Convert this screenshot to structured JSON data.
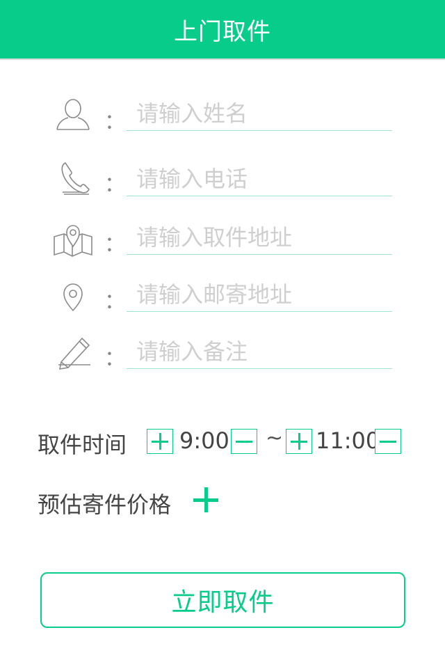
{
  "header": {
    "title": "上门取件"
  },
  "form": {
    "colon": "：",
    "fields": [
      {
        "icon": "person-icon",
        "placeholder": "请输入姓名",
        "value": ""
      },
      {
        "icon": "phone-icon",
        "placeholder": "请输入电话",
        "value": ""
      },
      {
        "icon": "map-pin-icon",
        "placeholder": "请输入取件地址",
        "value": ""
      },
      {
        "icon": "location-pin-icon",
        "placeholder": "请输入邮寄地址",
        "value": ""
      },
      {
        "icon": "pencil-icon",
        "placeholder": "请输入备注",
        "value": ""
      }
    ]
  },
  "pickup_time": {
    "label": "取件时间",
    "start": "9:00",
    "separator": "~",
    "end": "11:00"
  },
  "price_estimate": {
    "label": "预估寄件价格"
  },
  "submit": {
    "label": "立即取件"
  },
  "colors": {
    "accent": "#07cc8a",
    "underline": "#9fe6cb",
    "placeholder": "#cfcfcf"
  }
}
